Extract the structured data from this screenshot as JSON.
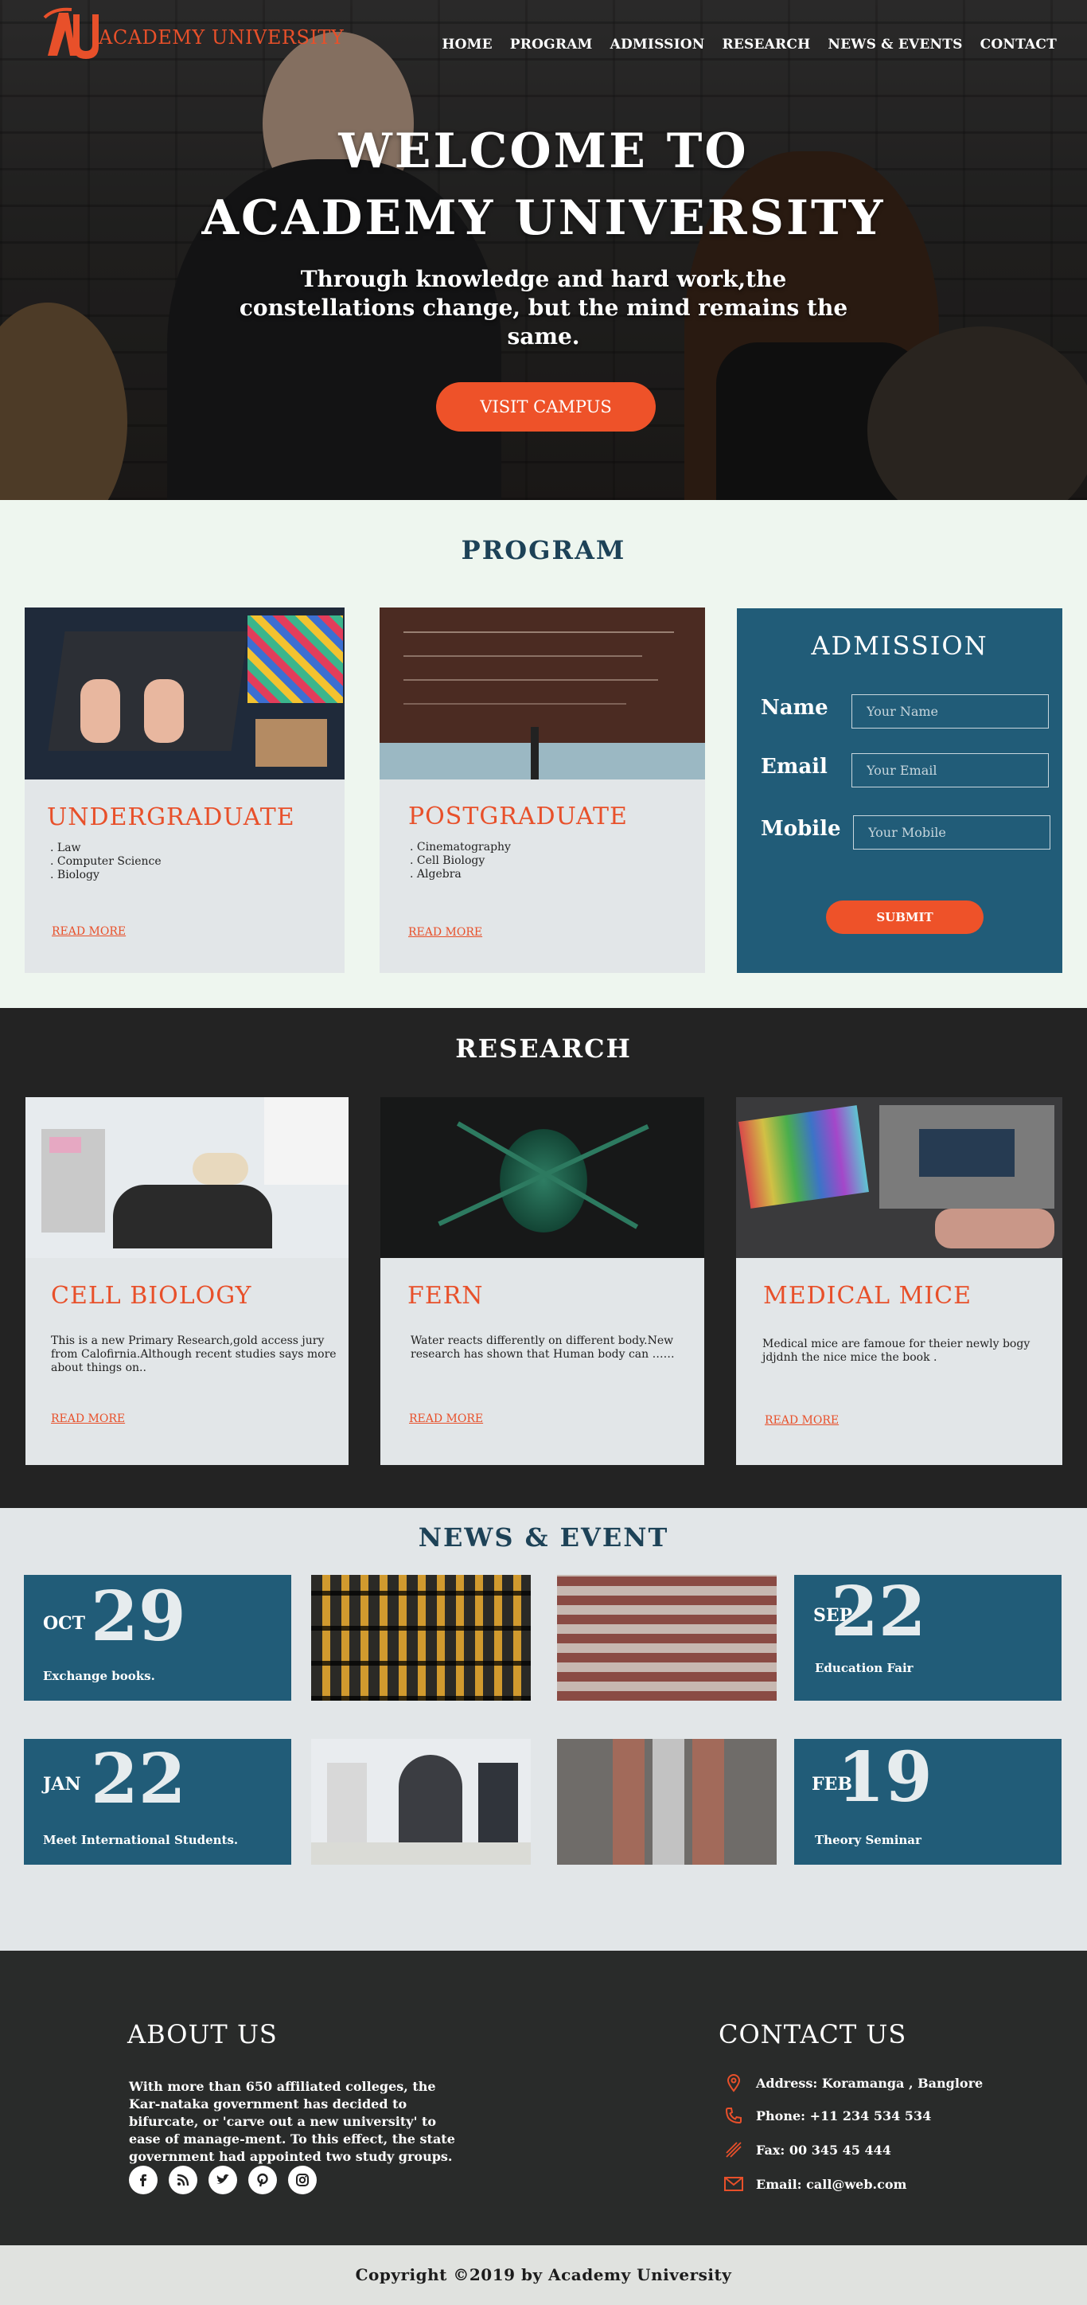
{
  "brand": {
    "name": "ACADEMY UNIVERSITY",
    "accent": "#ee5229",
    "navy": "#215c78"
  },
  "nav": [
    "HOME",
    "PROGRAM",
    "ADMISSION",
    "RESEARCH",
    "NEWS & EVENTS",
    "CONTACT"
  ],
  "hero": {
    "title_line1": "WELCOME TO",
    "title_line2": "ACADEMY UNIVERSITY",
    "subtitle": "Through knowledge and hard work,the constellations change, but the mind remains the same.",
    "button": "VISIT CAMPUS"
  },
  "program": {
    "title": "PROGRAM",
    "cards": [
      {
        "title": "UNDERGRADUATE",
        "items": [
          ". Law",
          ". Computer Science",
          ". Biology"
        ],
        "link": "READ MORE"
      },
      {
        "title": "POSTGRADUATE",
        "items": [
          ". Cinematography",
          ". Cell Biology",
          ". Algebra"
        ],
        "link": "READ MORE"
      }
    ],
    "admission": {
      "title": "ADMISSION",
      "fields": [
        {
          "label": "Name",
          "placeholder": "Your Name"
        },
        {
          "label": "Email",
          "placeholder": "Your Email"
        },
        {
          "label": "Mobile",
          "placeholder": "Your Mobile"
        }
      ],
      "submit": "SUBMIT"
    }
  },
  "research": {
    "title": "RESEARCH",
    "cards": [
      {
        "title": "CELL BIOLOGY",
        "text": "This is a new Primary Research,gold access jury from Calofirnia.Although recent studies says more about things on..",
        "link": "READ MORE"
      },
      {
        "title": "FERN",
        "text": "Water reacts differently on different body.New research has shown that Human body can ……",
        "link": "READ MORE"
      },
      {
        "title": "MEDICAL MICE",
        "text": "Medical mice are famoue for theier newly bogy jdjdnh the nice mice the book .",
        "link": "READ MORE"
      }
    ]
  },
  "news": {
    "title": "NEWS & EVENT",
    "events": [
      {
        "month": "OCT",
        "day": "29",
        "desc": "Exchange books."
      },
      {
        "month": "SEP",
        "day": "22",
        "desc": "Education Fair"
      },
      {
        "month": "JAN",
        "day": "22",
        "desc": "Meet International Students."
      },
      {
        "month": "FEB",
        "day": "19",
        "desc": "Theory Seminar"
      }
    ]
  },
  "footer": {
    "about_title": "ABOUT US",
    "about_text": "With more than 650 affiliated colleges, the Kar-nataka government has decided to bifurcate, or 'carve out a new university' to ease of manage-ment. To this effect, the state government had appointed two study groups.",
    "contact_title": "CONTACT US",
    "address": "Address: Koramanga , Banglore",
    "phone": "Phone: +11 234 534 534",
    "fax": "Fax: 00 345 45 444",
    "email": "Email: call@web.com",
    "socials": [
      "facebook-icon",
      "rss-icon",
      "twitter-icon",
      "pinterest-icon",
      "instagram-icon"
    ]
  },
  "copyright": "Copyright ©2019 by Academy University"
}
